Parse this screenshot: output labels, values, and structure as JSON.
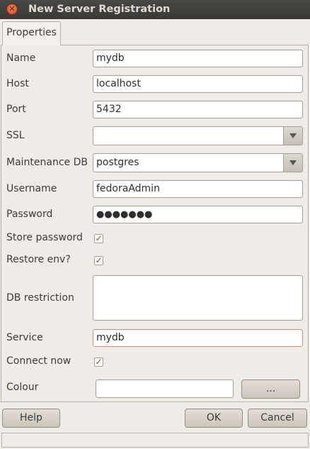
{
  "window": {
    "title": "New Server Registration",
    "close_icon": "close-icon"
  },
  "tabs": [
    {
      "label": "Properties",
      "active": true
    }
  ],
  "form": {
    "name": {
      "label": "Name",
      "value": "mydb"
    },
    "host": {
      "label": "Host",
      "value": "localhost"
    },
    "port": {
      "label": "Port",
      "value": "5432"
    },
    "ssl": {
      "label": "SSL",
      "value": ""
    },
    "maintenance_db": {
      "label": "Maintenance DB",
      "value": "postgres"
    },
    "username": {
      "label": "Username",
      "value": "fedoraAdmin"
    },
    "password": {
      "label": "Password",
      "value": "●●●●●●●"
    },
    "store_password": {
      "label": "Store password",
      "checked": true
    },
    "restore_env": {
      "label": "Restore env?",
      "checked": true
    },
    "db_restriction": {
      "label": "DB restriction",
      "value": ""
    },
    "service": {
      "label": "Service",
      "value": "mydb"
    },
    "connect_now": {
      "label": "Connect now",
      "checked": true
    },
    "colour": {
      "label": "Colour",
      "value": "",
      "button_label": "..."
    }
  },
  "buttons": {
    "help": "Help",
    "ok": "OK",
    "cancel": "Cancel"
  },
  "colors": {
    "titlebar": "#3e3d39",
    "checkmark": "#c03a1c",
    "focus_border": "#d9896f"
  }
}
